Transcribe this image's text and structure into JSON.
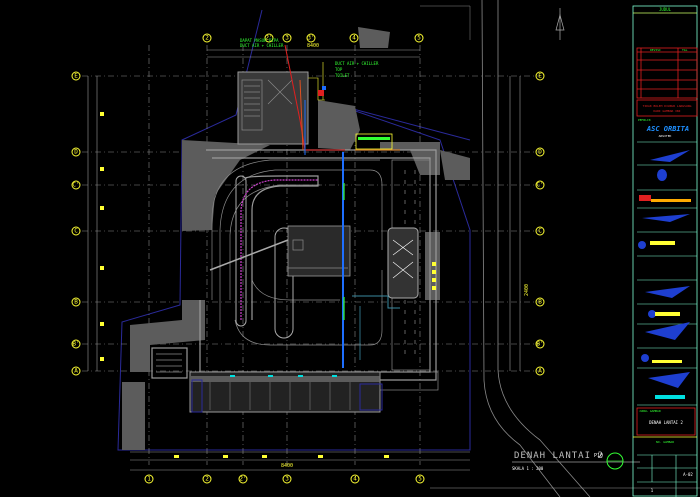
{
  "drawing": {
    "title": "DENAH LANTAI 2",
    "scale": "SKALA 1 : 200",
    "sheet_code": "P10",
    "overall_dimension_top": "8400",
    "overall_dimension_bottom": "8400",
    "overall_dimension_right": "2400"
  },
  "grid": {
    "rows": [
      "E",
      "D",
      "C'",
      "C",
      "B",
      "B'",
      "A"
    ],
    "columns_top": [
      "2",
      "2'",
      "3",
      "3'",
      "4",
      "5"
    ],
    "columns_bottom": [
      "1",
      "2",
      "2'",
      "3",
      "4",
      "5"
    ]
  },
  "annotations": {
    "pipe_label_1": "DAPAT MASUK PIPA",
    "pipe_label_2": "DUCT AIR + CHILLER",
    "pipe_label_3": "TOP",
    "pipe_label_4": "TOILET"
  },
  "title_block": {
    "header": "JUDUL",
    "revision_col_1": "REVISI",
    "revision_col_2": "TGL",
    "note_line_1": "TIDAK BOLEH DIUKUR LANGSUNG",
    "note_line_2": "DARI GAMBAR INI",
    "owner_label": "PEMILIK",
    "logo_text": "ASC ORBITA",
    "logo_sub": "ARSITEK",
    "sheet_title_label": "JUDUL GAMBAR",
    "sheet_title": "DENAH LANTAI 2",
    "drawing_no_label": "NO. GAMBAR",
    "drawing_no": "A-02",
    "page": "1"
  },
  "colors": {
    "background": "#000000",
    "grid_bubble": "#ffff33",
    "title_block": "#7fffd4",
    "revision_table": "#e02020",
    "pipe_blue": "#1e6fff",
    "pipe_red": "#e02020",
    "site_boundary": "#2a2a9a"
  }
}
